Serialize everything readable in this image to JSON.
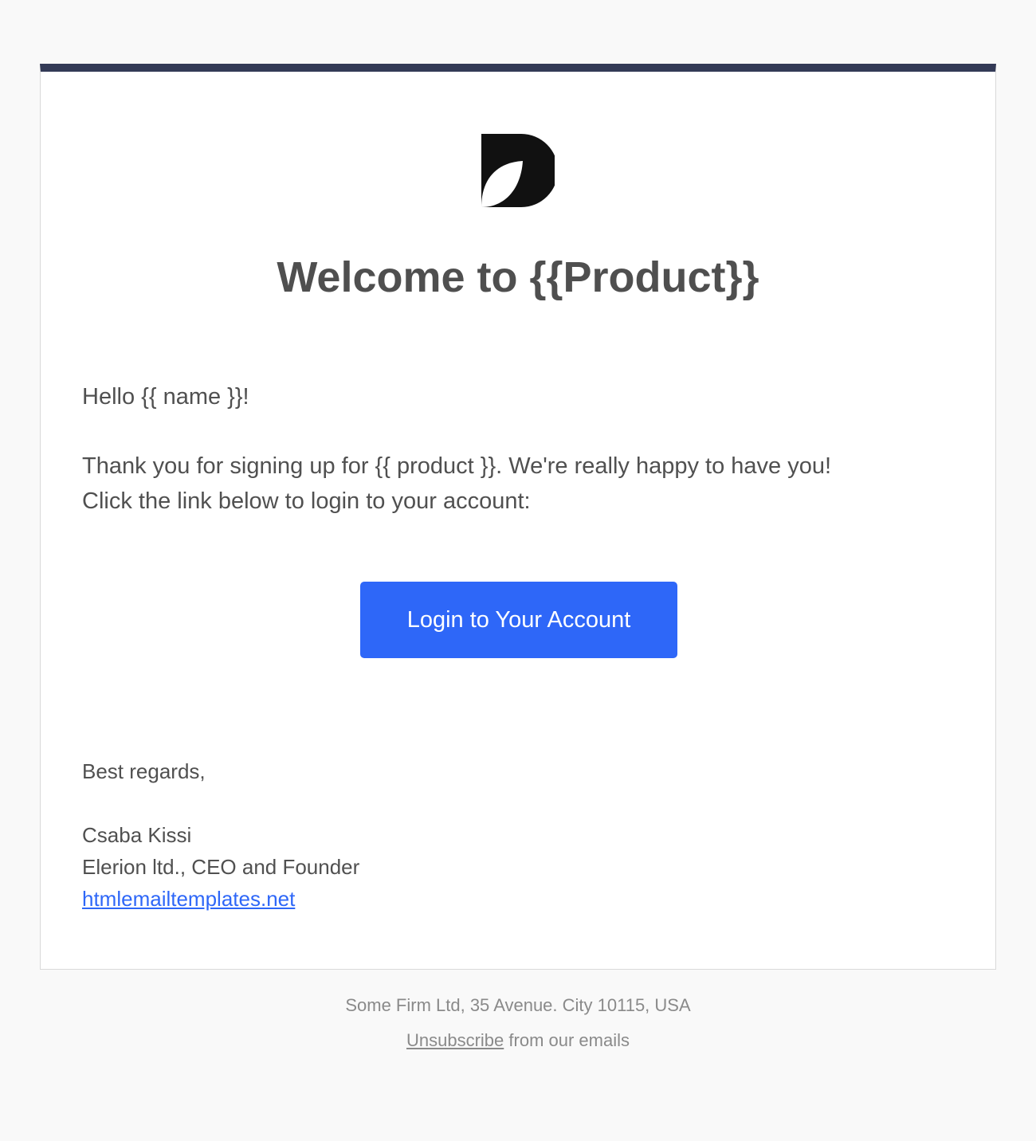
{
  "email": {
    "accent_color": "#333a56",
    "button_color": "#2e67f8",
    "logo_icon": "d-leaf-logo-icon",
    "title": "Welcome to {{Product}}",
    "greeting": "Hello {{ name }}!",
    "body_line1": "Thank you for signing up for {{ product }}. We're really happy to have you!",
    "body_line2": "Click the link below to login to your account:",
    "cta_label": "Login to Your Account",
    "regards": "Best regards,",
    "signature": {
      "name": "Csaba Kissi",
      "role": "Elerion ltd., CEO and Founder",
      "link_text": "htmlemailtemplates.net"
    }
  },
  "footer": {
    "address": "Some Firm Ltd, 35 Avenue. City 10115, USA",
    "unsubscribe_link": "Unsubscribe",
    "unsubscribe_suffix": " from our emails"
  }
}
